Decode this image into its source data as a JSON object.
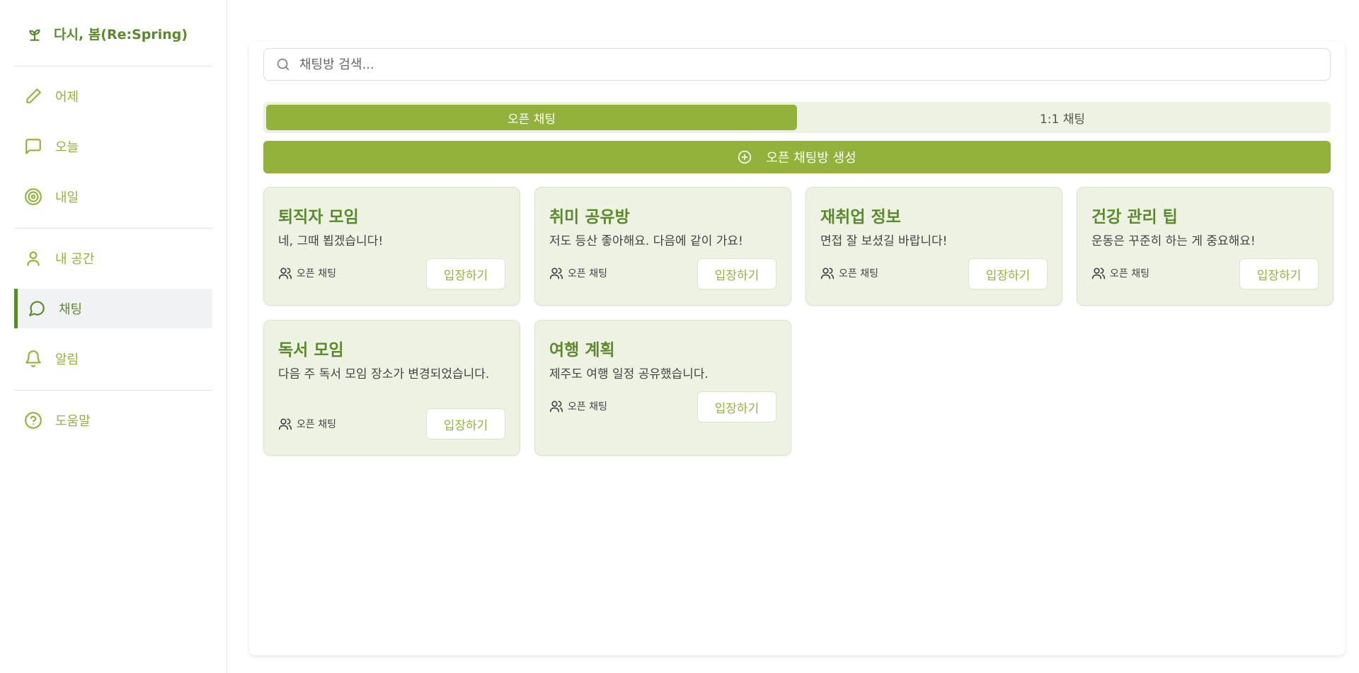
{
  "brand": {
    "name": "다시, 봄(Re:Spring)",
    "icon": "sprout-icon"
  },
  "sidebar": {
    "items": [
      {
        "label": "어제",
        "icon": "pencil-icon"
      },
      {
        "label": "오늘",
        "icon": "message-square-icon"
      },
      {
        "label": "내일",
        "icon": "target-icon"
      },
      {
        "label": "내 공간",
        "icon": "user-icon"
      },
      {
        "label": "채팅",
        "icon": "message-circle-icon",
        "active": true
      },
      {
        "label": "알림",
        "icon": "bell-icon"
      },
      {
        "label": "도움말",
        "icon": "help-circle-icon"
      }
    ]
  },
  "search": {
    "placeholder": "채팅방 검색...",
    "value": ""
  },
  "tabs": [
    {
      "label": "오픈 채팅",
      "active": true
    },
    {
      "label": "1:1 채팅",
      "active": false
    }
  ],
  "create_button": {
    "label": "오픈 채팅방 생성"
  },
  "rooms": [
    {
      "title": "퇴직자 모임",
      "last_message": "네, 그때 뵙겠습니다!",
      "type": "오픈 채팅",
      "action": "입장하기"
    },
    {
      "title": "취미 공유방",
      "last_message": "저도 등산 좋아해요. 다음에 같이 가요!",
      "type": "오픈 채팅",
      "action": "입장하기"
    },
    {
      "title": "재취업 정보",
      "last_message": "면접 잘 보셨길 바랍니다!",
      "type": "오픈 채팅",
      "action": "입장하기"
    },
    {
      "title": "건강 관리 팁",
      "last_message": "운동은 꾸준히 하는 게 중요해요!",
      "type": "오픈 채팅",
      "action": "입장하기"
    },
    {
      "title": "독서 모임",
      "last_message": "다음 주 독서 모임 장소가 변경되었습니다.",
      "type": "오픈 채팅",
      "action": "입장하기"
    },
    {
      "title": "여행 계획",
      "last_message": "제주도 여행 일정 공유했습니다.",
      "type": "오픈 채팅",
      "action": "입장하기"
    }
  ],
  "colors": {
    "accent": "#93b23c",
    "brand": "#5b8a2c",
    "card_bg": "#eef2e3"
  }
}
